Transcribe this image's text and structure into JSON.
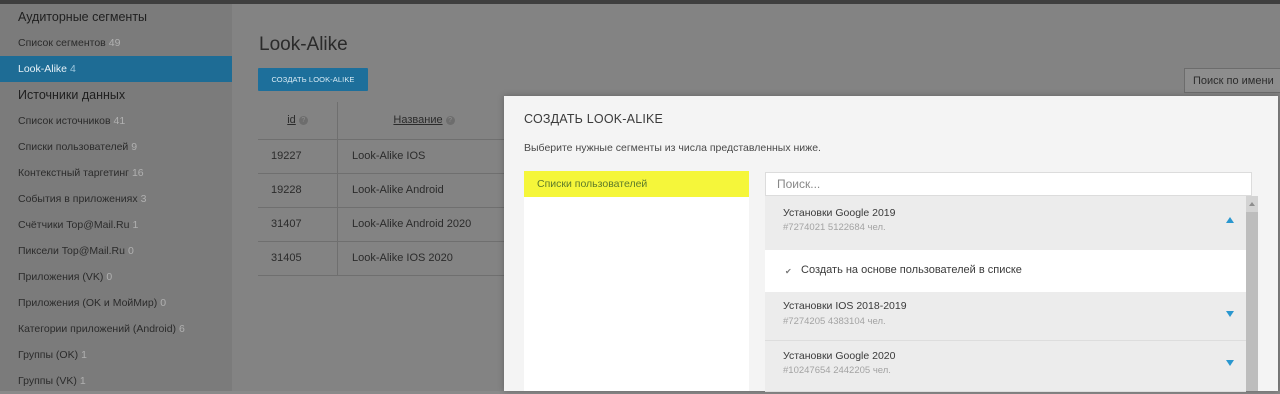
{
  "sidebar": {
    "sections": [
      {
        "title": "Аудиторные сегменты",
        "items": [
          {
            "label": "Список сегментов",
            "count": "49"
          },
          {
            "label": "Look-Alike",
            "count": "4",
            "active": true
          }
        ]
      },
      {
        "title": "Источники данных",
        "items": [
          {
            "label": "Список источников",
            "count": "41"
          },
          {
            "label": "Списки пользователей",
            "count": "9"
          },
          {
            "label": "Контекстный таргетинг",
            "count": "16"
          },
          {
            "label": "События в приложениях",
            "count": "3"
          },
          {
            "label": "Счётчики Top@Mail.Ru",
            "count": "1"
          },
          {
            "label": "Пиксели Top@Mail.Ru",
            "count": "0"
          },
          {
            "label": "Приложения (VK)",
            "count": "0"
          },
          {
            "label": "Приложения (OK и МойМир)",
            "count": "0"
          },
          {
            "label": "Категории приложений (Android)",
            "count": "6"
          },
          {
            "label": "Группы (OK)",
            "count": "1"
          },
          {
            "label": "Группы (VK)",
            "count": "1"
          }
        ]
      }
    ]
  },
  "main": {
    "title": "Look-Alike",
    "create_button": "СОЗДАТЬ LOOK-ALIKE",
    "search_placeholder": "Поиск по имени",
    "table": {
      "headers": {
        "id": "id",
        "name": "Название"
      },
      "rows": [
        {
          "id": "19227",
          "name": "Look-Alike IOS"
        },
        {
          "id": "19228",
          "name": "Look-Alike Android"
        },
        {
          "id": "31407",
          "name": "Look-Alike Android 2020"
        },
        {
          "id": "31405",
          "name": "Look-Alike IOS 2020"
        }
      ]
    }
  },
  "modal": {
    "title": "СОЗДАТЬ LOOK-ALIKE",
    "subtitle": "Выберите нужные сегменты из числа представленных ниже.",
    "lists_selected": "Списки пользователей",
    "search_placeholder": "Поиск...",
    "segments": [
      {
        "name": "Установки Google 2019",
        "meta": "#7274021 5122684 чел.",
        "expanded": true
      },
      {
        "name": "Установки IOS 2018-2019",
        "meta": "#7274205 4383104 чел.",
        "expanded": false
      },
      {
        "name": "Установки Google 2020",
        "meta": "#10247654 2442205 чел.",
        "expanded": false
      }
    ],
    "checkbox_label": "Создать на основе пользователей в списке"
  },
  "colors": {
    "accent": "#1d6f9b",
    "arrow": "#2a97cf",
    "highlight": "#f5f63a"
  }
}
